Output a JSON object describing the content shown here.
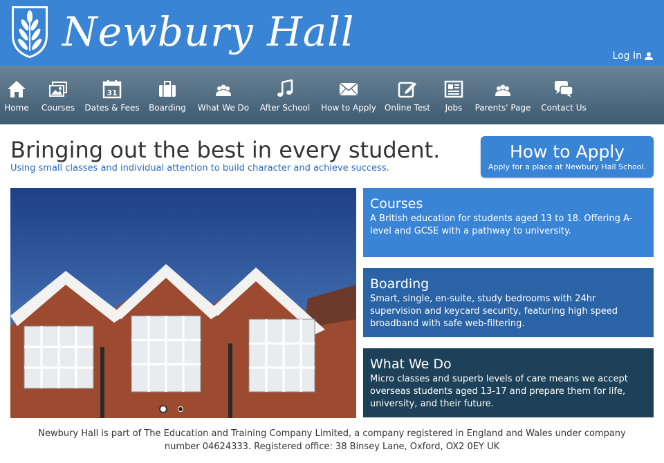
{
  "header": {
    "site_title": "Newbury Hall",
    "login_label": "Log In"
  },
  "nav": {
    "items": [
      {
        "label": "Home",
        "icon": "home-icon"
      },
      {
        "label": "Courses",
        "icon": "pictures-icon"
      },
      {
        "label": "Dates & Fees",
        "icon": "calendar-icon"
      },
      {
        "label": "Boarding",
        "icon": "suitcase-icon"
      },
      {
        "label": "What We Do",
        "icon": "people-icon"
      },
      {
        "label": "After School",
        "icon": "music-icon"
      },
      {
        "label": "How to Apply",
        "icon": "envelope-icon"
      },
      {
        "label": "Online Test",
        "icon": "edit-icon"
      },
      {
        "label": "Jobs",
        "icon": "newspaper-icon"
      },
      {
        "label": "Parents' Page",
        "icon": "people-icon"
      },
      {
        "label": "Contact Us",
        "icon": "chat-icon"
      }
    ],
    "calendar_day": "31"
  },
  "main": {
    "headline": "Bringing out the best in every student.",
    "tagline": "Using small classes and individual attention to build character and achieve success.",
    "apply": {
      "title": "How to Apply",
      "subtitle": "Apply for a place at Newbury Hall School."
    },
    "panels": [
      {
        "title": "Courses",
        "text": "A British education for students aged 13 to 18. Offering A-level and GCSE with a pathway to university.",
        "color": "#3a84d6"
      },
      {
        "title": "Boarding",
        "text": "Smart, single, en-suite, study bedrooms with 24hr supervision and keycard security, featuring high speed broadband with safe web-filtering.",
        "color": "#2a64a6"
      },
      {
        "title": "What We Do",
        "text": "Micro classes and superb levels of care means we accept overseas students aged 13-17 and prepare them for life, university, and their future.",
        "color": "#1d4158"
      }
    ]
  },
  "footer": {
    "text": "Newbury Hall is part of The Education and Training Company Limited, a company registered in England and Wales under company number 04624333. Registered office: 38 Binsey Lane, Oxford, OX2 0EY UK"
  },
  "colors": {
    "brand_blue": "#3a84d6",
    "nav_dark": "#3f5a70"
  }
}
